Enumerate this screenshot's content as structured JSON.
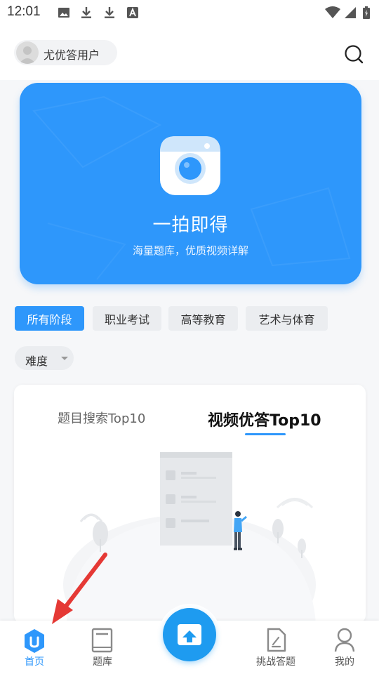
{
  "status_bar": {
    "time": "12:01",
    "left_icons": [
      "image-icon",
      "download-icon",
      "download-icon",
      "text-a-icon"
    ],
    "right_icons": [
      "wifi-icon",
      "signal-icon",
      "battery-icon"
    ]
  },
  "header": {
    "username": "尤优答用户",
    "search_icon": "search-icon"
  },
  "hero": {
    "title": "一拍即得",
    "subtitle": "海量题库，优质视频详解",
    "icon": "camera-icon",
    "color": "#2e97fb"
  },
  "filters": {
    "tabs": [
      {
        "label": "所有阶段",
        "active": true
      },
      {
        "label": "职业考试",
        "active": false
      },
      {
        "label": "高等教育",
        "active": false
      },
      {
        "label": "艺术与体育",
        "active": false
      }
    ],
    "difficulty_label": "难度"
  },
  "ranking_card": {
    "tabs": [
      {
        "label": "题目搜索Top10",
        "active": false
      },
      {
        "label": "视频优答Top10",
        "active": true
      }
    ]
  },
  "bottom_nav": {
    "items": [
      {
        "label": "首页",
        "icon": "home-icon",
        "active": true
      },
      {
        "label": "题库",
        "icon": "book-icon",
        "active": false
      },
      {
        "label": "",
        "icon": "upload-camera-icon",
        "active": false
      },
      {
        "label": "挑战答题",
        "icon": "challenge-icon",
        "active": false
      },
      {
        "label": "我的",
        "icon": "profile-icon",
        "active": false
      }
    ]
  },
  "colors": {
    "accent": "#2e97fb",
    "annotation_arrow": "#e53935"
  }
}
